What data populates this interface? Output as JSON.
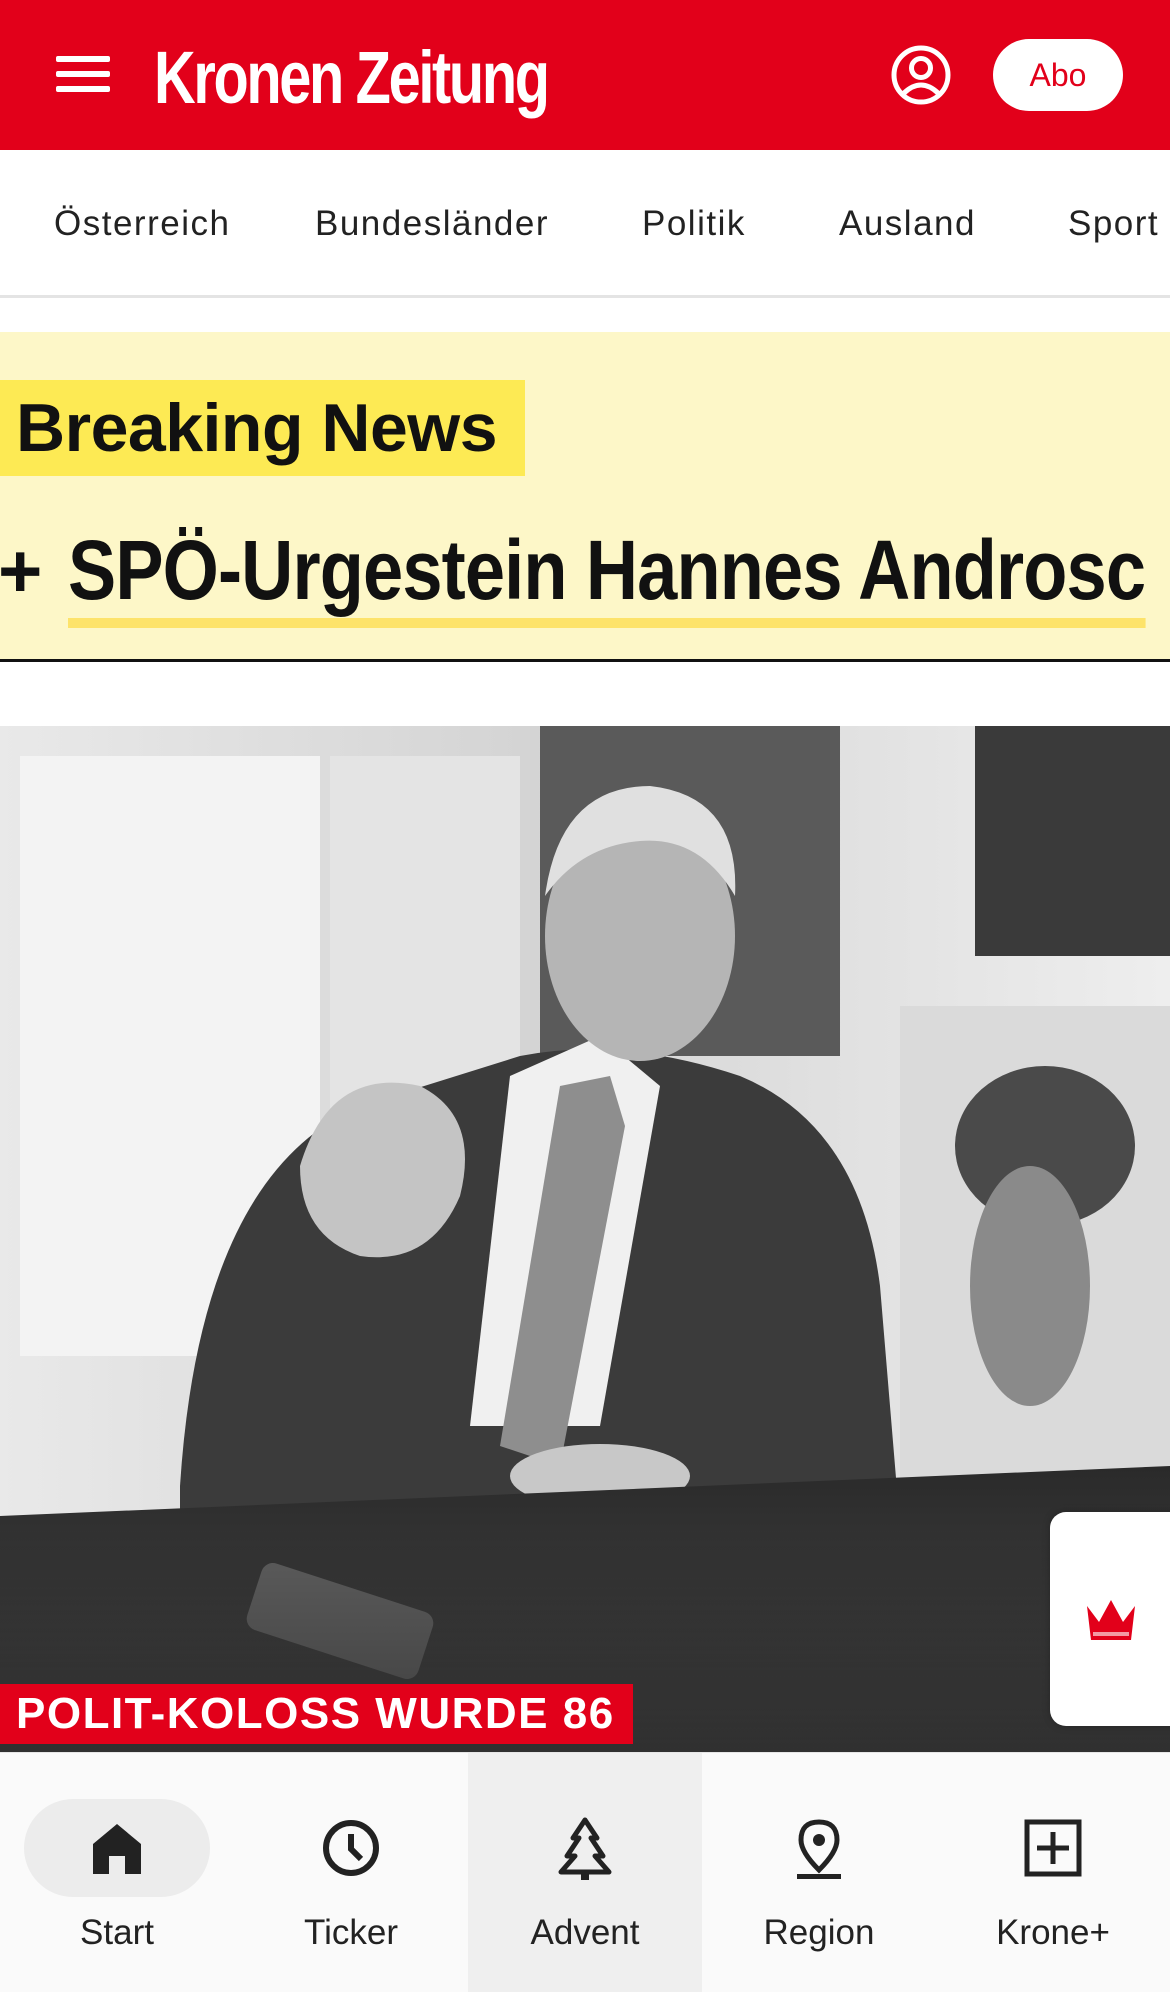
{
  "header": {
    "logo": "Kronen Zeitung",
    "abo_label": "Abo",
    "brand_color": "#e2001a",
    "icons": [
      "hamburger-menu-icon",
      "user-account-icon"
    ]
  },
  "category_nav": {
    "items": [
      {
        "label": "Österreich"
      },
      {
        "label": "Bundesländer"
      },
      {
        "label": "Politik"
      },
      {
        "label": "Ausland"
      },
      {
        "label": "Sport"
      }
    ]
  },
  "breaking": {
    "label": "Breaking News",
    "plus": "+",
    "headline": "SPÖ-Urgestein Hannes Androsc",
    "background_color": "#fdf7c8",
    "label_color": "#fdea54"
  },
  "hero": {
    "kicker": "POLIT-KOLOSS WURDE 86",
    "image": "black-and-white photo of elderly man in suit gesturing at a table"
  },
  "krone_tab": {
    "icon": "krone-crown-icon"
  },
  "bottom_nav": {
    "items": [
      {
        "label": "Start",
        "icon": "home-icon"
      },
      {
        "label": "Ticker",
        "icon": "clock-icon"
      },
      {
        "label": "Advent",
        "icon": "tree-icon"
      },
      {
        "label": "Region",
        "icon": "location-pin-icon"
      },
      {
        "label": "Krone+",
        "icon": "plus-box-icon"
      }
    ]
  }
}
